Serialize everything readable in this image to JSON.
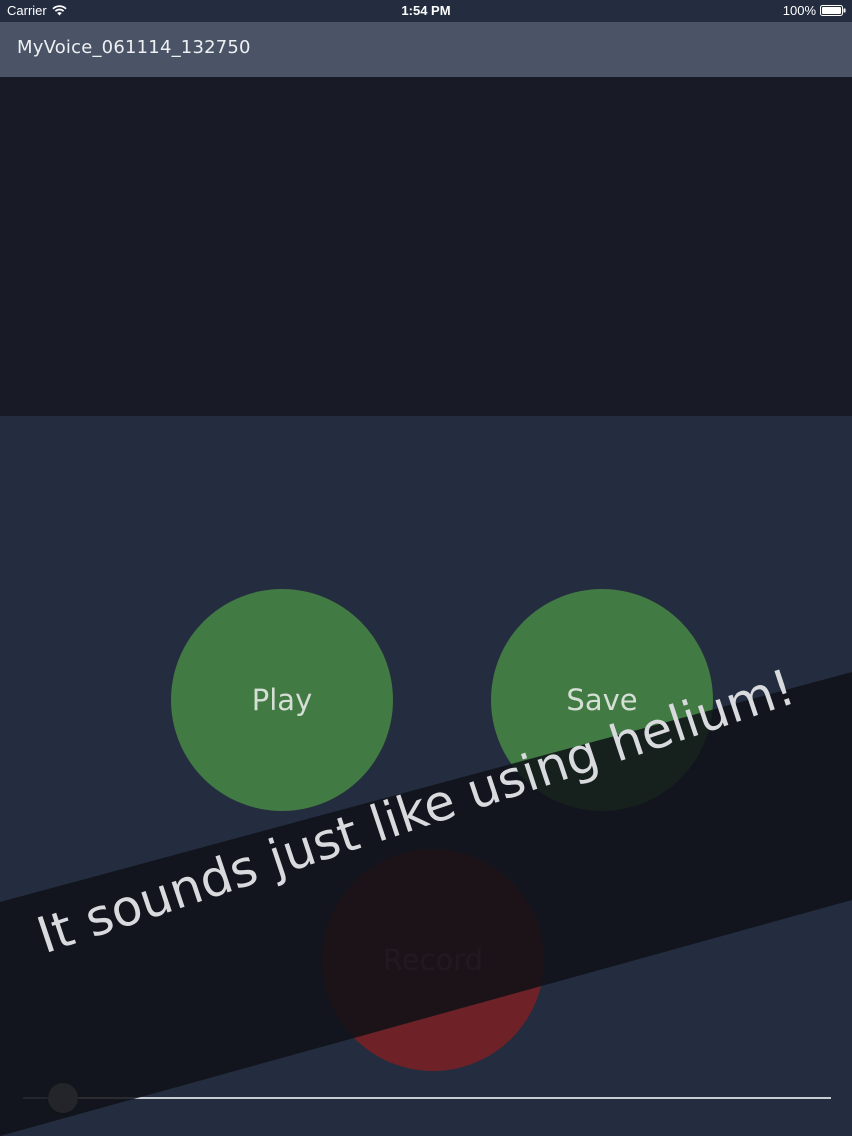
{
  "status_bar": {
    "carrier": "Carrier",
    "time": "1:54 PM",
    "battery": "100%",
    "icons": [
      "wifi-icon",
      "battery-icon"
    ]
  },
  "title_bar": {
    "title": "MyVoice_061114_132750"
  },
  "controls": {
    "play_label": "Play",
    "save_label": "Save",
    "record_label": "Record"
  },
  "slider": {
    "value": 0.05
  },
  "promo": {
    "text": "It sounds just like using helium!"
  },
  "colors": {
    "background": "#232d3f",
    "title_bar": "#4a5466",
    "waveform_area": "#181b25",
    "play_save_button": "#427a43",
    "record_button": "#6e2228",
    "banner": "#0f1117"
  }
}
